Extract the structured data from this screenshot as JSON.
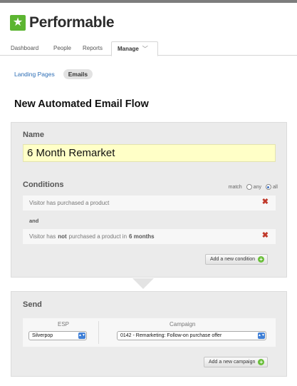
{
  "app": {
    "logo_text": "Performable",
    "logo_icon": "star-icon"
  },
  "nav": {
    "items": [
      "Dashboard",
      "People",
      "Reports"
    ],
    "active_tab": "Manage",
    "active_tab_icon": "chevron-down-icon"
  },
  "subnav": {
    "link": "Landing Pages",
    "active": "Emails"
  },
  "page": {
    "title": "New Automated Email Flow"
  },
  "name_section": {
    "label": "Name",
    "value": "6 Month Remarket"
  },
  "conditions": {
    "label": "Conditions",
    "match_label": "match",
    "option_any": "any",
    "option_all": "all",
    "selected": "all",
    "row1": "Visitor has purchased a product",
    "joiner": "and",
    "row2": {
      "prefix": "Visitor has",
      "negation": "not",
      "middle": "purchased a product in",
      "period": "6 months"
    },
    "add_button": "Add a new condition"
  },
  "send": {
    "label": "Send",
    "esp_label": "ESP",
    "esp_value": "Silverpop",
    "campaign_label": "Campaign",
    "campaign_value": "0142 - Remarketing: Follow-on purchase offer",
    "add_button": "Add a new campaign"
  },
  "colors": {
    "brand_green": "#5cb531",
    "link_blue": "#2d6eb5",
    "name_highlight": "#ffffc7",
    "remove_red": "#c0392b"
  }
}
